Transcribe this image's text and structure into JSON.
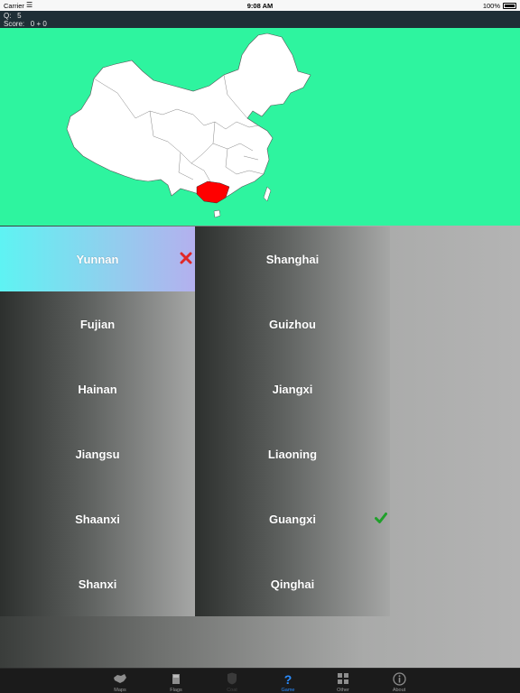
{
  "status_bar": {
    "carrier": "Carrier",
    "time": "9:08 AM",
    "battery": "100%"
  },
  "quiz": {
    "question_label": "Q:",
    "question_number": "5",
    "score_label": "Score:",
    "score_value": "0 + 0"
  },
  "map": {
    "background_color": "#2ef49f",
    "highlight_color": "#ff0000",
    "highlighted_province": "Guangxi"
  },
  "answers": {
    "left": [
      {
        "label": "Yunnan",
        "state": "wrong"
      },
      {
        "label": "Fujian",
        "state": "none"
      },
      {
        "label": "Hainan",
        "state": "none"
      },
      {
        "label": "Jiangsu",
        "state": "none"
      },
      {
        "label": "Shaanxi",
        "state": "none"
      },
      {
        "label": "Shanxi",
        "state": "none"
      }
    ],
    "right": [
      {
        "label": "Shanghai",
        "state": "none"
      },
      {
        "label": "Guizhou",
        "state": "none"
      },
      {
        "label": "Jiangxi",
        "state": "none"
      },
      {
        "label": "Liaoning",
        "state": "none"
      },
      {
        "label": "Guangxi",
        "state": "correct"
      },
      {
        "label": "Qinghai",
        "state": "none"
      }
    ]
  },
  "icons": {
    "wrong": "x-mark-icon",
    "correct": "check-mark-icon"
  },
  "tabs": [
    {
      "label": "Maps",
      "icon": "map-icon",
      "state": "normal"
    },
    {
      "label": "Flags",
      "icon": "flag-book-icon",
      "state": "normal"
    },
    {
      "label": "Coat",
      "icon": "shield-icon",
      "state": "disabled"
    },
    {
      "label": "Game",
      "icon": "question-icon",
      "state": "active"
    },
    {
      "label": "Other",
      "icon": "grid-icon",
      "state": "normal"
    },
    {
      "label": "About",
      "icon": "info-icon",
      "state": "normal"
    }
  ]
}
